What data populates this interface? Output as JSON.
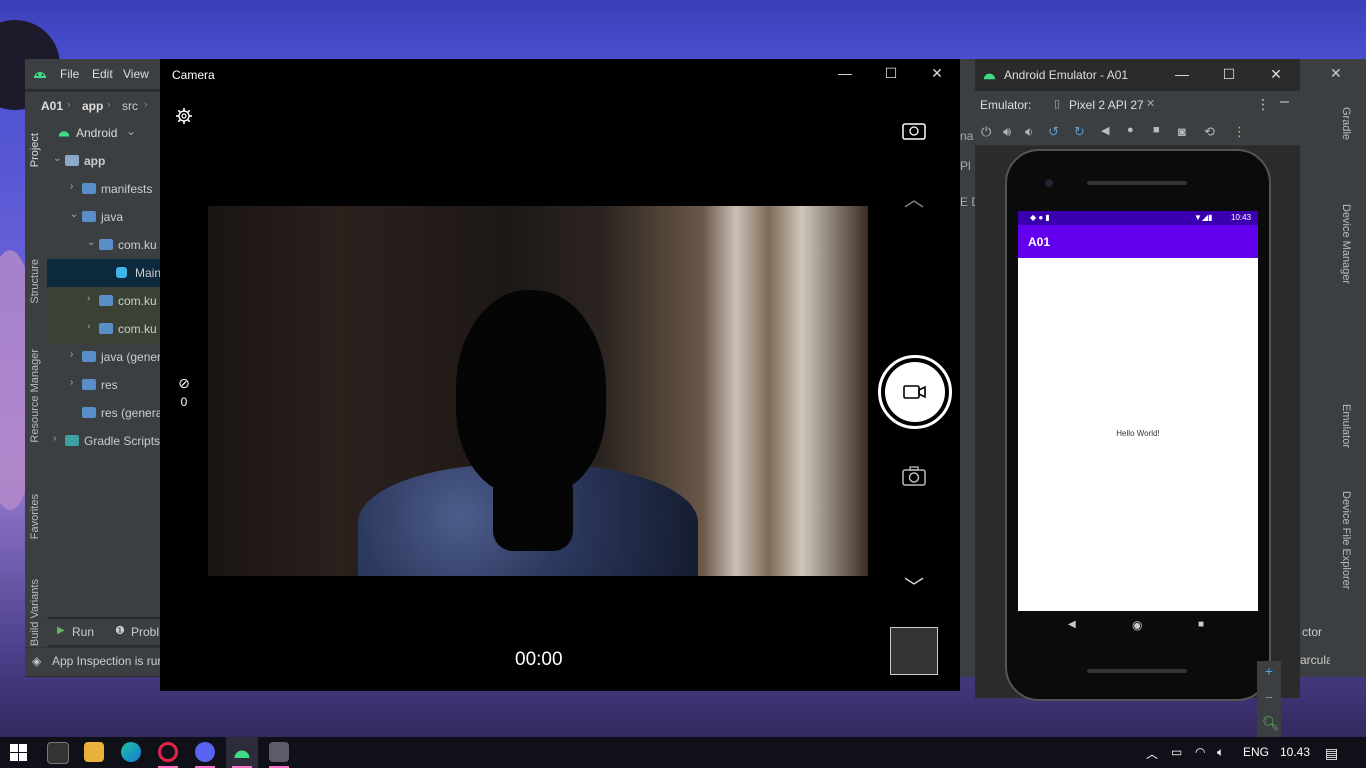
{
  "studio": {
    "menu": [
      "File",
      "Edit",
      "View"
    ],
    "breadcrumb": [
      "A01",
      "app",
      "src"
    ],
    "project_view": "Android",
    "tree": [
      {
        "label": "app",
        "depth": 0,
        "arrow": "v",
        "icon": "module"
      },
      {
        "label": "manifests",
        "depth": 1,
        "arrow": ">",
        "icon": "folder"
      },
      {
        "label": "java",
        "depth": 1,
        "arrow": "v",
        "icon": "folder"
      },
      {
        "label": "com.ku",
        "depth": 2,
        "arrow": "v",
        "icon": "folder"
      },
      {
        "label": "Main",
        "depth": 3,
        "arrow": "",
        "icon": "class"
      },
      {
        "label": "com.ku",
        "depth": 2,
        "arrow": ">",
        "icon": "folder"
      },
      {
        "label": "com.ku",
        "depth": 2,
        "arrow": ">",
        "icon": "folder"
      },
      {
        "label": "java (gener",
        "depth": 1,
        "arrow": ">",
        "icon": "folder"
      },
      {
        "label": "res",
        "depth": 1,
        "arrow": ">",
        "icon": "folder"
      },
      {
        "label": "res (genera",
        "depth": 1,
        "arrow": "",
        "icon": "folder"
      },
      {
        "label": "Gradle Scripts",
        "depth": 0,
        "arrow": ">",
        "icon": "gradle"
      }
    ],
    "left_tabs": [
      "Project",
      "Structure",
      "Resource Manager",
      "Favorites",
      "Build Variants"
    ],
    "right_tabs": [
      "Gradle",
      "Device Manager",
      "Emulator",
      "Device File Explorer"
    ],
    "bottom_tabs": [
      "Run",
      "Probl"
    ],
    "status": "App Inspection is rur",
    "partial_right": [
      "ctor",
      "arcula"
    ],
    "partial_mid": [
      "na",
      "Pl",
      "E D"
    ]
  },
  "camera": {
    "title": "Camera",
    "timer": "00:00",
    "exposure_value": "0"
  },
  "emulator": {
    "title": "Android Emulator - A01",
    "label": "Emulator:",
    "device_tab": "Pixel 2 API 27",
    "device_time": "10:43",
    "app_title": "A01",
    "content_text": "Hello World!"
  },
  "taskbar": {
    "language": "ENG",
    "time": "10.43"
  }
}
